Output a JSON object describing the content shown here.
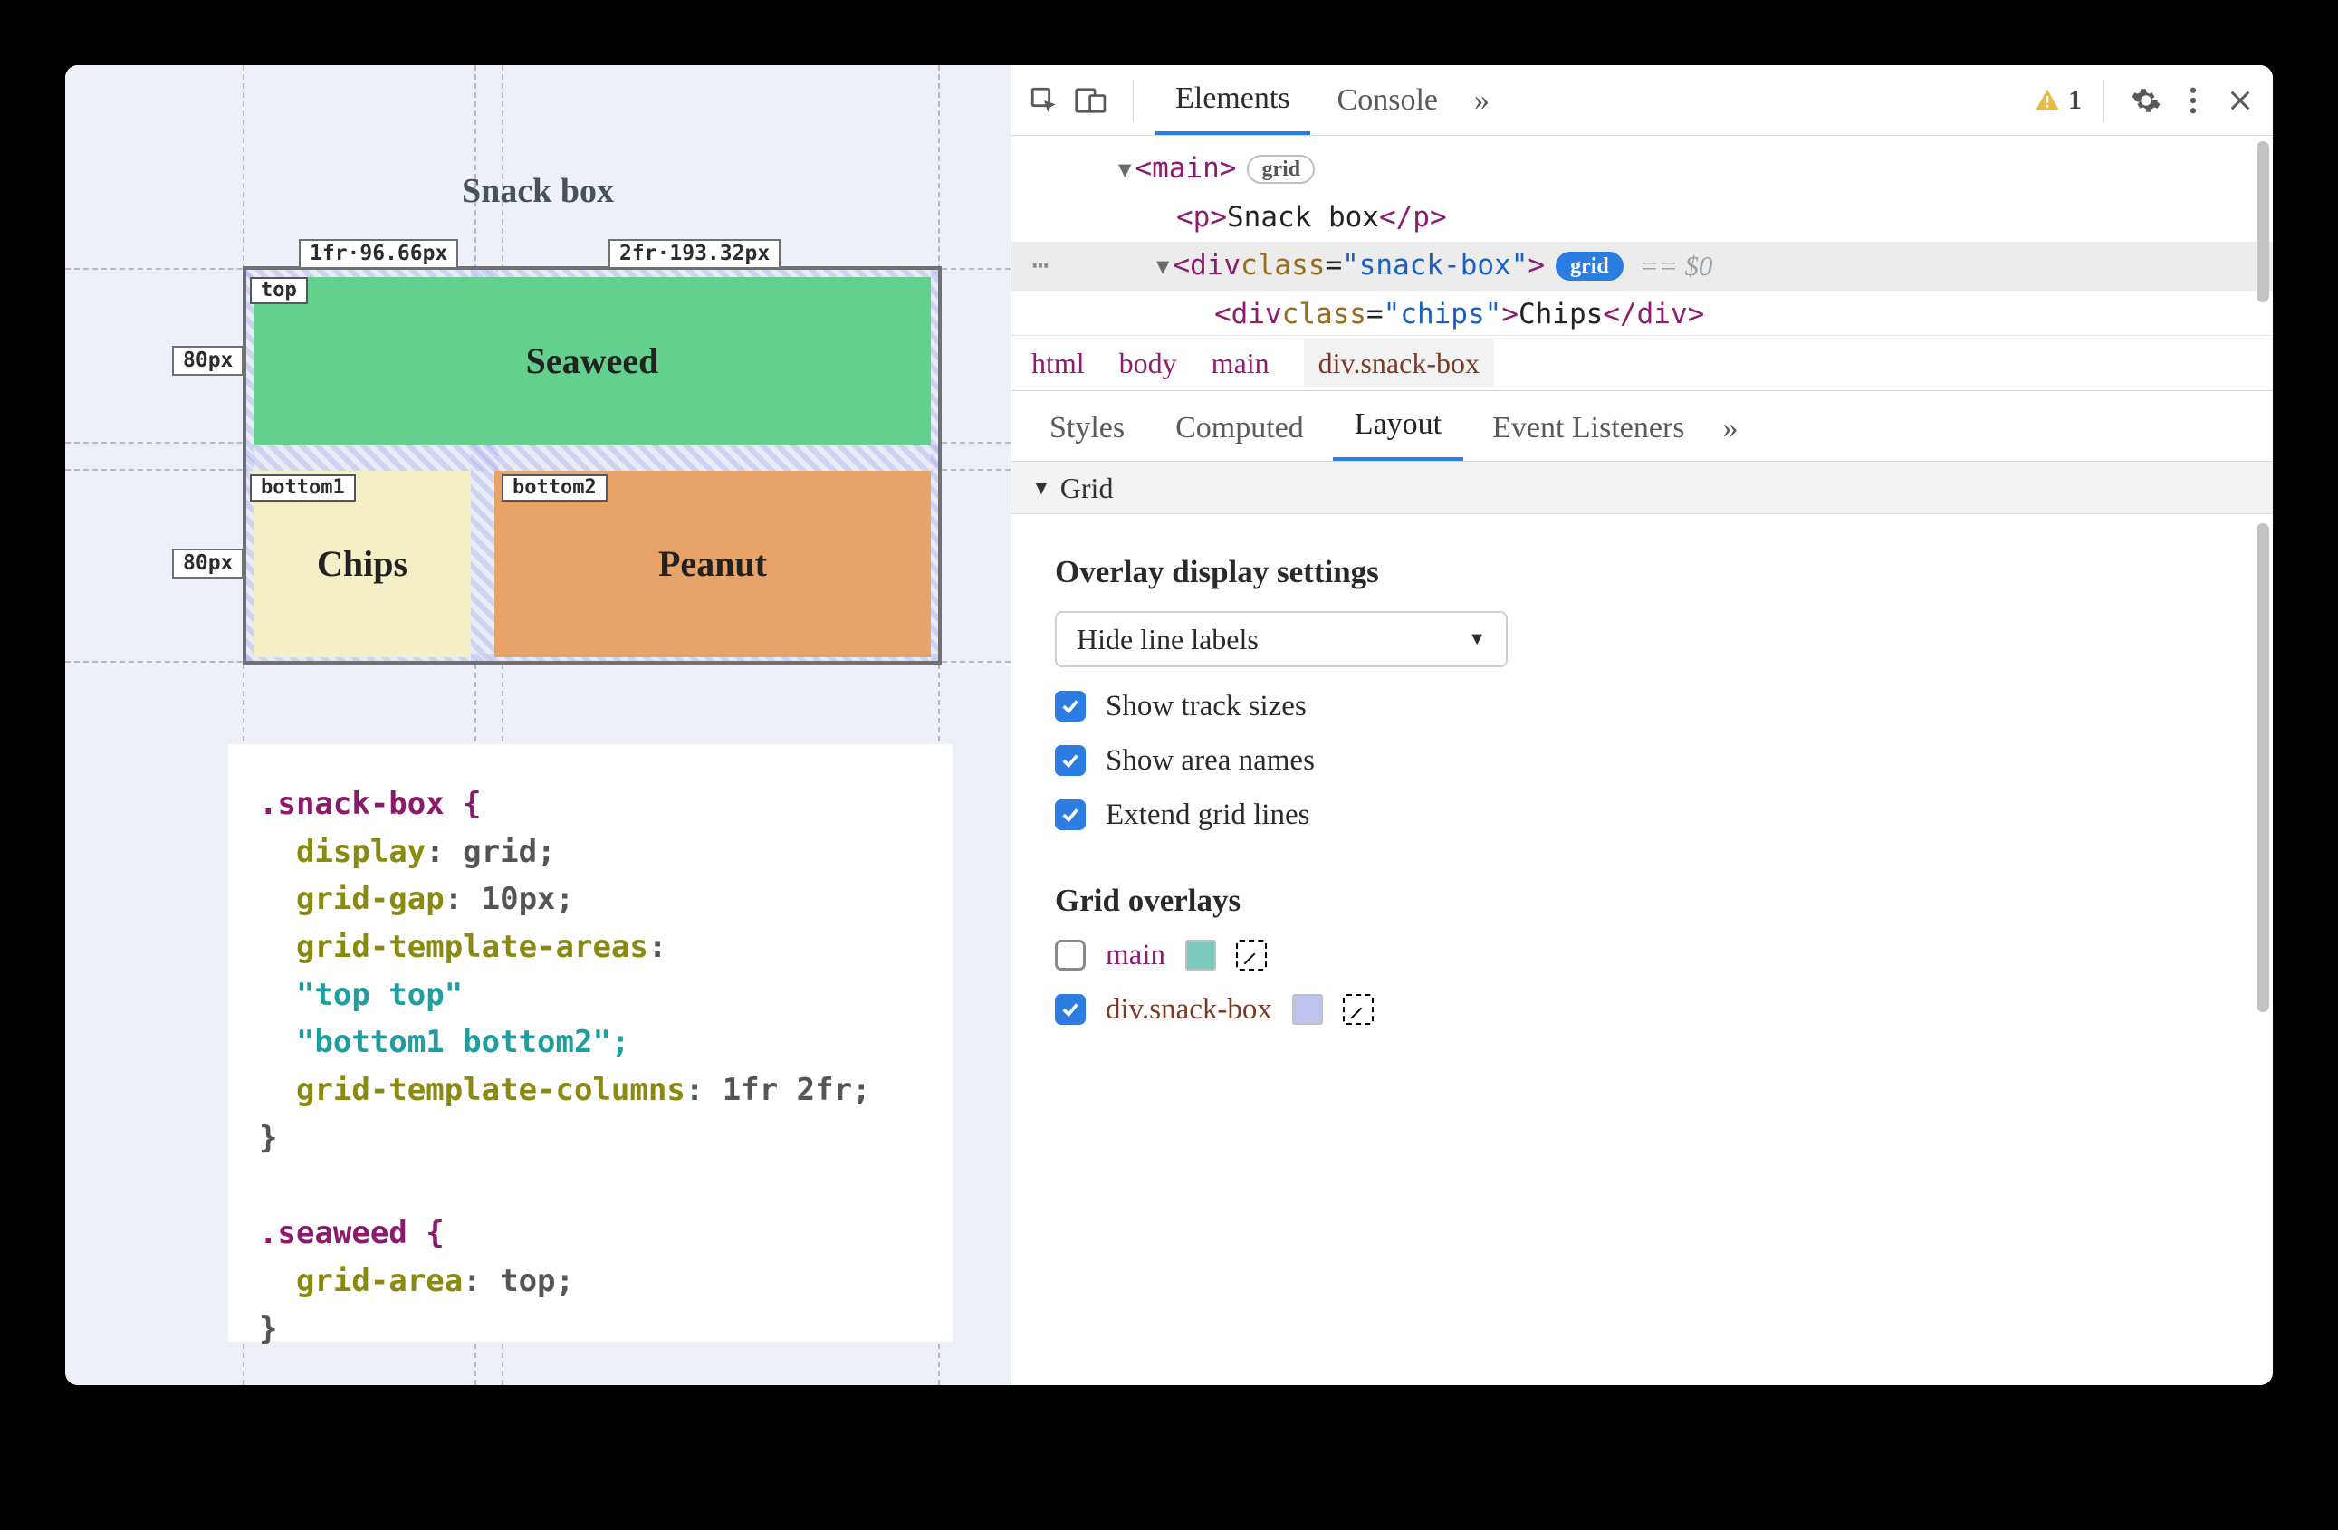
{
  "page": {
    "title": "Snack box",
    "tracks": {
      "col1": "1fr·96.66px",
      "col2": "2fr·193.32px",
      "row1": "80px",
      "row2": "80px"
    },
    "areas": {
      "top": "top",
      "b1": "bottom1",
      "b2": "bottom2"
    },
    "cells": {
      "seaweed": "Seaweed",
      "chips": "Chips",
      "peanut": "Peanut"
    }
  },
  "css": {
    "l1": ".snack-box {",
    "l2a": "  display",
    "l2b": ": grid;",
    "l3a": "  grid-gap",
    "l3b": ": 10px;",
    "l4a": "  grid-template-areas",
    "l4b": ":",
    "l5": "  \"top top\"",
    "l6": "  \"bottom1 bottom2\";",
    "l7a": "  grid-template-columns",
    "l7b": ": 1fr 2fr;",
    "l8": "}",
    "l9": "",
    "l10": ".seaweed {",
    "l11a": "  grid-area",
    "l11b": ": top;",
    "l12": "}"
  },
  "toolbar": {
    "tabs": {
      "elements": "Elements",
      "console": "Console"
    },
    "more": "»",
    "warn": "1"
  },
  "dom": {
    "main_open": "<main>",
    "main_badge": "grid",
    "p_open": "<p>",
    "p_text": "Snack box",
    "p_close": "</p>",
    "div_open_a": "<div ",
    "div_cls_n": "class",
    "div_cls_v": "\"snack-box\"",
    "div_open_b": ">",
    "div_badge": "grid",
    "eqdlr": "== $0",
    "chips_tag_open": "<div ",
    "chips_cls_n": "class",
    "chips_cls_v": "\"chips\"",
    "chips_txt": "Chips",
    "chips_close": "</div>"
  },
  "crumb": {
    "a": "html",
    "b": "body",
    "c": "main",
    "d": "div.snack-box"
  },
  "subtabs": {
    "styles": "Styles",
    "computed": "Computed",
    "layout": "Layout",
    "ev": "Event Listeners",
    "more": "»"
  },
  "grid": {
    "sec": "Grid",
    "overlay_h": "Overlay display settings",
    "select": "Hide line labels",
    "opt1": "Show track sizes",
    "opt2": "Show area names",
    "opt3": "Extend grid lines",
    "overlays_h": "Grid overlays",
    "ov_main": "main",
    "ov_sb": "div.snack-box"
  }
}
